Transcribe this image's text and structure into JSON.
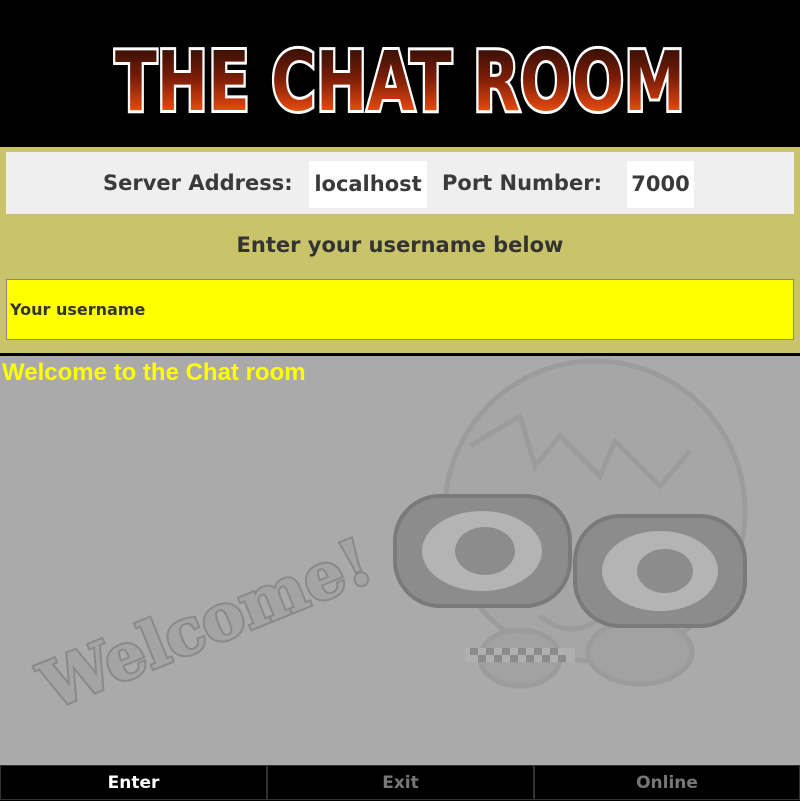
{
  "header": {
    "logo_text": "THE CHAT ROOM"
  },
  "connection": {
    "server_label": "Server Address:",
    "server_value": "localhost",
    "port_label": "Port Number:",
    "port_value": "7000"
  },
  "login": {
    "prompt": "Enter your username below",
    "username_placeholder": "Your username"
  },
  "chat": {
    "welcome_message": "Welcome to the Chat room",
    "background_text": "Welcome!"
  },
  "buttons": {
    "enter": "Enter",
    "exit": "Exit",
    "online": "Online"
  },
  "colors": {
    "panel_bg": "#c9c46a",
    "username_bg": "#ffff00",
    "chat_bg": "#aaaaaa",
    "welcome_text": "#ffff00"
  }
}
